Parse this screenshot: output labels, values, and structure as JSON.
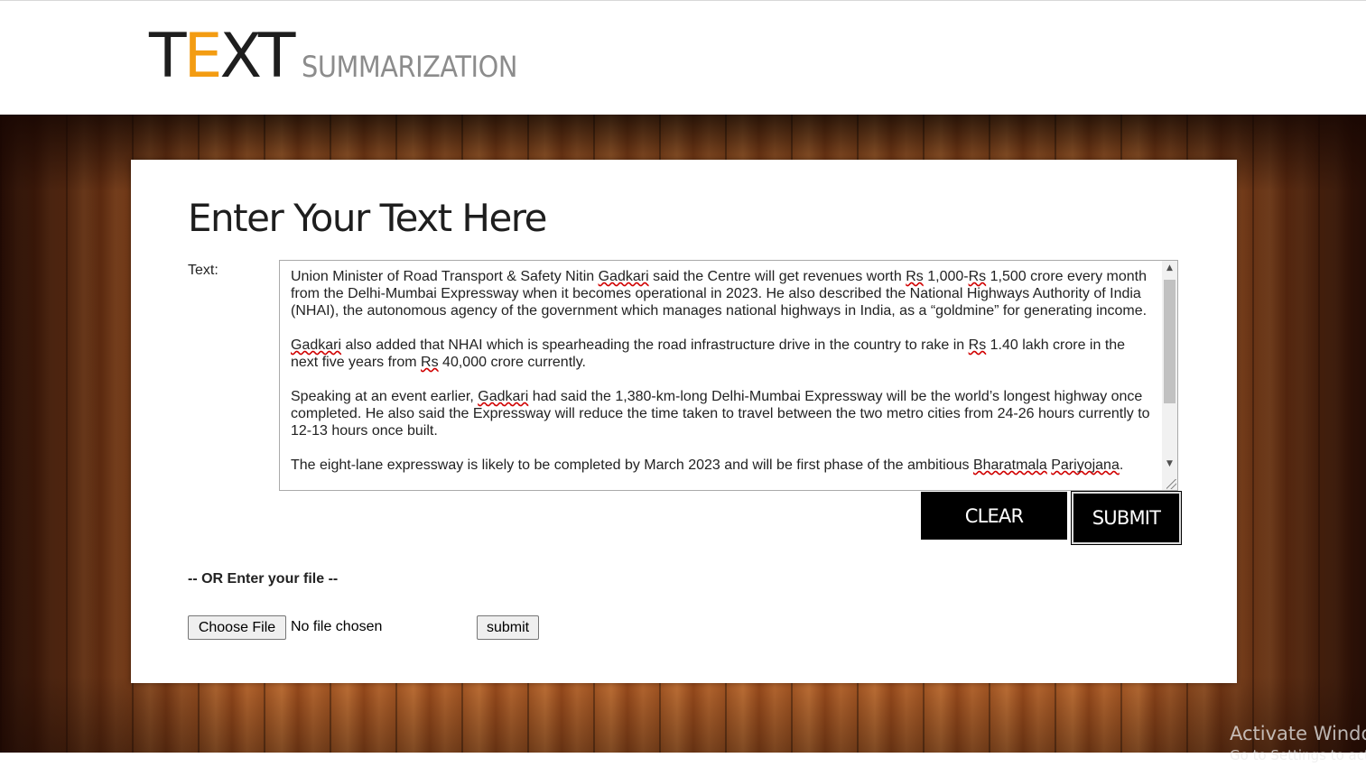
{
  "header": {
    "logo": {
      "part1": "T",
      "accent": "E",
      "part2": "XT",
      "subtitle": "SUMMARIZATION"
    }
  },
  "form": {
    "heading": "Enter Your Text Here",
    "text_label": "Text:",
    "textarea": {
      "paragraphs": [
        " Union Minister of Road Transport & Safety Nitin Gadkari said the Centre will get revenues worth Rs 1,000-Rs 1,500 crore every month from the Delhi-Mumbai Expressway when it becomes operational in 2023. He also described the National Highways Authority of India (NHAI), the autonomous agency of the government which manages national highways in India, as a “goldmine” for generating income.",
        "Gadkari also added that NHAI which is spearheading the road infrastructure drive in the country to rake in Rs 1.40 lakh crore in the next five years from Rs 40,000 crore currently.",
        "Speaking at an event earlier, Gadkari had said the 1,380-km-long Delhi-Mumbai Expressway will be the world’s longest highway once completed. He also said the Expressway will reduce the time taken to travel between the two metro cities from 24-26 hours currently to 12-13 hours once built.",
        "The eight-lane expressway is likely to be completed by March 2023 and will be first phase of the ambitious Bharatmala Pariyojana."
      ]
    },
    "clear_label": "CLEAR",
    "submit_label": "SUBMIT"
  },
  "file_upload": {
    "or_label": "-- OR Enter your file --",
    "choose_label": "Choose File",
    "status": "No file chosen",
    "submit_label": "submit"
  },
  "watermark": {
    "line1": "Activate Windows",
    "line2": "Go to Settings to activate Windows."
  },
  "colors": {
    "accent": "#f39c12",
    "button_bg": "#000000",
    "wood": "#a55623"
  },
  "icons": {
    "scroll_up": "triangle-up",
    "scroll_down": "triangle-down",
    "resize": "resize-grip"
  }
}
